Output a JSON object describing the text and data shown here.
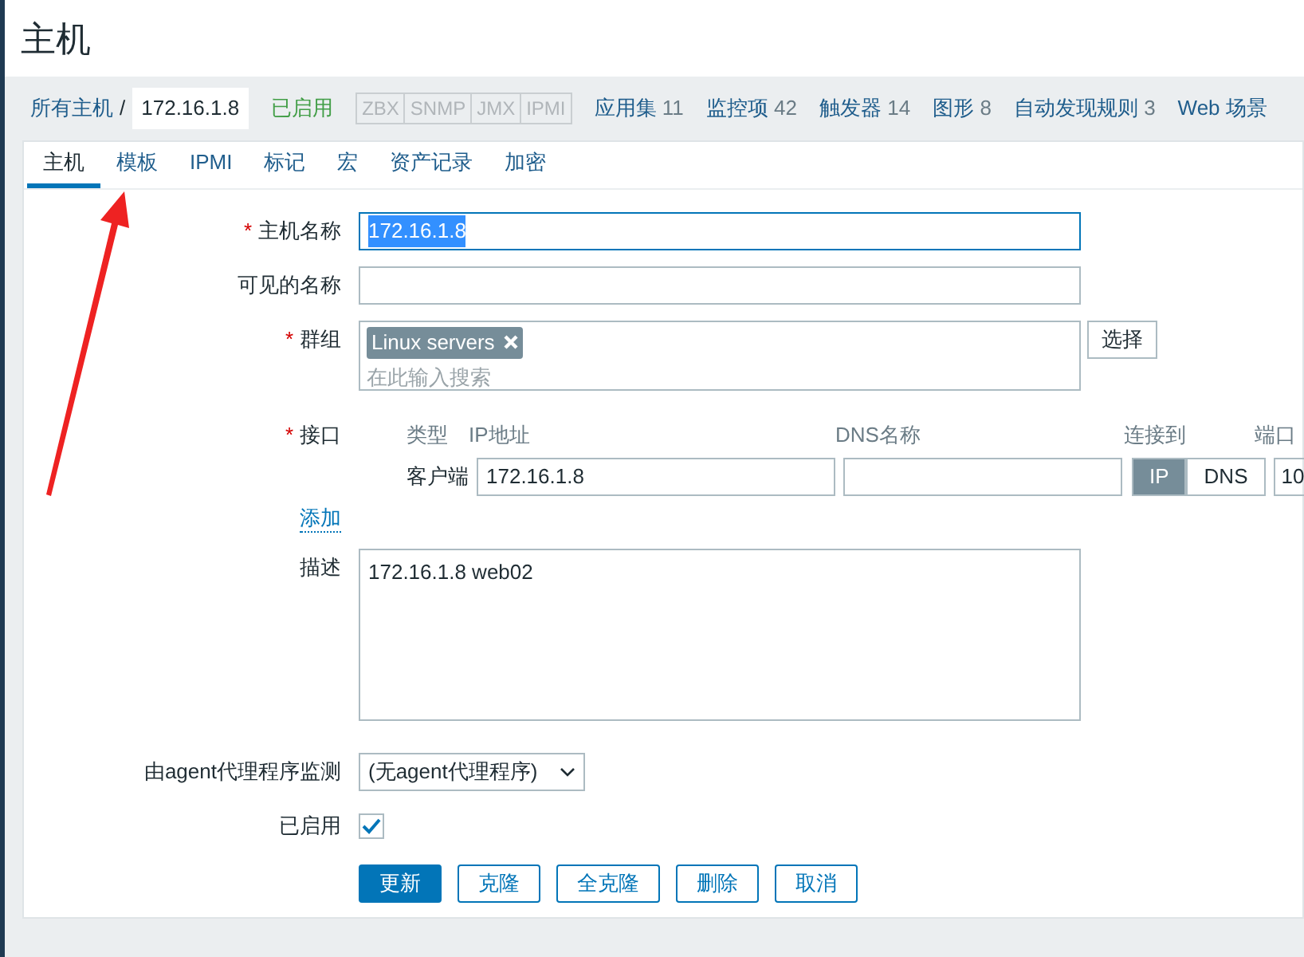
{
  "page_title": "主机",
  "breadcrumb": {
    "root": "所有主机",
    "separator": "/",
    "current": "172.16.1.8",
    "status": "已启用",
    "availability": [
      {
        "label": "ZBX"
      },
      {
        "label": "SNMP"
      },
      {
        "label": "JMX"
      },
      {
        "label": "IPMI"
      }
    ],
    "links": [
      {
        "label": "应用集",
        "count": "11"
      },
      {
        "label": "监控项",
        "count": "42"
      },
      {
        "label": "触发器",
        "count": "14"
      },
      {
        "label": "图形",
        "count": "8"
      },
      {
        "label": "自动发现规则",
        "count": "3"
      },
      {
        "label": "Web 场景"
      }
    ]
  },
  "tabs": [
    {
      "label": "主机",
      "selected": true
    },
    {
      "label": "模板",
      "selected": false
    },
    {
      "label": "IPMI",
      "selected": false
    },
    {
      "label": "标记",
      "selected": false
    },
    {
      "label": "宏",
      "selected": false
    },
    {
      "label": "资产记录",
      "selected": false
    },
    {
      "label": "加密",
      "selected": false
    }
  ],
  "form": {
    "host_name": {
      "label": "主机名称",
      "required_mark": "*",
      "value": "172.16.1.8"
    },
    "visible_name": {
      "label": "可见的名称"
    },
    "groups": {
      "label": "群组",
      "required_mark": "*",
      "tags": [
        "Linux servers"
      ],
      "placeholder": "在此输入搜索",
      "select_button": "选择"
    },
    "interfaces": {
      "label": "接口",
      "required_mark": "*",
      "columns": [
        "类型",
        "IP地址",
        "DNS名称",
        "连接到",
        "端口"
      ],
      "rows": [
        {
          "type": "客户端",
          "ip": "172.16.1.8",
          "connect": [
            {
              "label": "IP",
              "selected": true
            },
            {
              "label": "DNS",
              "selected": false
            }
          ],
          "port": "10"
        }
      ],
      "add_link": "添加"
    },
    "description": {
      "label": "描述",
      "value": "172.16.1.8 web02"
    },
    "proxy": {
      "label": "由agent代理程序监测",
      "value": "(无agent代理程序)"
    },
    "enabled": {
      "label": "已启用",
      "checked": true
    },
    "buttons": [
      {
        "label": "更新",
        "primary": true
      },
      {
        "label": "克隆",
        "primary": false
      },
      {
        "label": "全克隆",
        "primary": false
      },
      {
        "label": "删除",
        "primary": false
      },
      {
        "label": "取消",
        "primary": false
      }
    ]
  }
}
